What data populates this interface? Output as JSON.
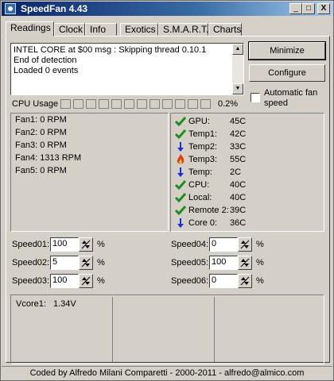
{
  "window": {
    "title": "SpeedFan 4.43"
  },
  "title_buttons": {
    "minimize": "_",
    "maximize": "□",
    "close": "X"
  },
  "tabs": [
    {
      "label": "Readings"
    },
    {
      "label": "Clock"
    },
    {
      "label": "Info"
    },
    {
      "label": "Exotics"
    },
    {
      "label": "S.M.A.R.T."
    },
    {
      "label": "Charts"
    }
  ],
  "log": {
    "lines": [
      "INTEL CORE at $00 msg : Skipping thread 0.10.1",
      "End of detection",
      "Loaded 0 events"
    ]
  },
  "buttons": {
    "minimize": "Minimize",
    "configure": "Configure"
  },
  "auto_fan": {
    "label": "Automatic fan speed",
    "checked": false
  },
  "cpu": {
    "label": "CPU Usage",
    "percent": "0.2%",
    "cells": 12
  },
  "fans": [
    {
      "label": "Fan1:",
      "value": "0 RPM"
    },
    {
      "label": "Fan2:",
      "value": "0 RPM"
    },
    {
      "label": "Fan3:",
      "value": "0 RPM"
    },
    {
      "label": "Fan4:",
      "value": "1313 RPM"
    },
    {
      "label": "Fan5:",
      "value": "0 RPM"
    }
  ],
  "temps": [
    {
      "label": "GPU:",
      "value": "45C",
      "icon": "check-icon"
    },
    {
      "label": "Temp1:",
      "value": "42C",
      "icon": "check-icon"
    },
    {
      "label": "Temp2:",
      "value": "33C",
      "icon": "arrow-down-icon"
    },
    {
      "label": "Temp3:",
      "value": "55C",
      "icon": "fire-icon"
    },
    {
      "label": "Temp:",
      "value": "2C",
      "icon": "arrow-down-icon"
    },
    {
      "label": "CPU:",
      "value": "40C",
      "icon": "check-icon"
    },
    {
      "label": "Local:",
      "value": "40C",
      "icon": "check-icon"
    },
    {
      "label": "Remote 2:",
      "value": "39C",
      "icon": "check-icon"
    },
    {
      "label": "Core 0:",
      "value": "36C",
      "icon": "arrow-down-icon"
    }
  ],
  "speeds": [
    {
      "label": "Speed01:",
      "value": "100",
      "unit": "%"
    },
    {
      "label": "Speed02:",
      "value": "5",
      "unit": "%"
    },
    {
      "label": "Speed03:",
      "value": "100",
      "unit": "%"
    },
    {
      "label": "Speed04:",
      "value": "0",
      "unit": "%"
    },
    {
      "label": "Speed05:",
      "value": "100",
      "unit": "%"
    },
    {
      "label": "Speed06:",
      "value": "0",
      "unit": "%"
    }
  ],
  "voltages": [
    {
      "label": "Vcore1:",
      "value": "1.34V"
    }
  ],
  "status": {
    "text": "Coded by Alfredo Milani Comparetti - 2000-2011 - alfredo@almico.com"
  },
  "colors": {
    "check": "#1a8f1a",
    "arrow": "#1032e0",
    "fire": "#e04010",
    "title_start": "#0a246a",
    "title_end": "#a6caf0"
  }
}
